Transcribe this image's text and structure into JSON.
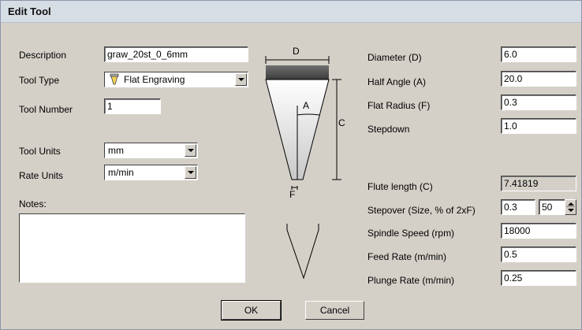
{
  "window": {
    "title": "Edit Tool"
  },
  "left": {
    "description_label": "Description",
    "description_value": "graw_20st_0_6mm",
    "tool_type_label": "Tool Type",
    "tool_type_value": "Flat Engraving",
    "tool_type_icon": "engraving-tool-icon",
    "tool_number_label": "Tool Number",
    "tool_number_value": "1",
    "tool_units_label": "Tool Units",
    "tool_units_value": "mm",
    "rate_units_label": "Rate Units",
    "rate_units_value": "m/min",
    "notes_label": "Notes:",
    "notes_value": ""
  },
  "diagram": {
    "label_d": "D",
    "label_a": "A",
    "label_c": "C",
    "label_f": "F"
  },
  "right": {
    "diameter_label": "Diameter (D)",
    "diameter_value": "6.0",
    "half_angle_label": "Half Angle (A)",
    "half_angle_value": "20.0",
    "flat_radius_label": "Flat Radius (F)",
    "flat_radius_value": "0.3",
    "stepdown_label": "Stepdown",
    "stepdown_value": "1.0",
    "flute_length_label": "Flute length (C)",
    "flute_length_value": "7.41819",
    "stepover_label": "Stepover (Size, % of 2xF)",
    "stepover_size_value": "0.3",
    "stepover_percent_value": "50",
    "spindle_speed_label": "Spindle Speed (rpm)",
    "spindle_speed_value": "18000",
    "feed_rate_label": "Feed Rate (m/min)",
    "feed_rate_value": "0.5",
    "plunge_rate_label": "Plunge Rate (m/min)",
    "plunge_rate_value": "0.25"
  },
  "buttons": {
    "ok_label": "OK",
    "cancel_label": "Cancel"
  }
}
